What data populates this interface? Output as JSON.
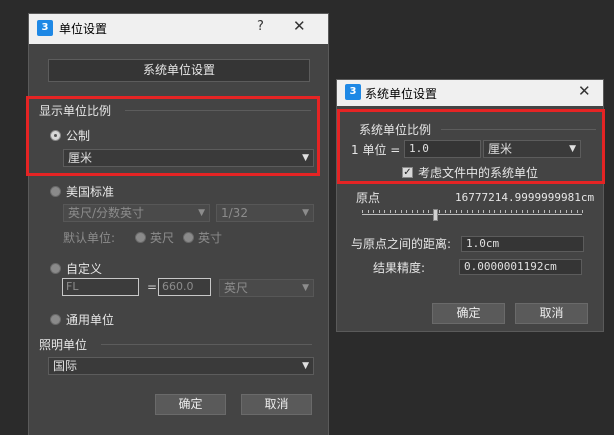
{
  "unit_setup_dialog": {
    "title": "单位设置",
    "icon": "3dsmax-app-icon",
    "help_label": "?",
    "close_label": "✕",
    "system_unit_setup_button": "系统单位设置",
    "display_group": {
      "title": "显示单位比例",
      "metric": {
        "label": "公制",
        "selected": true,
        "unit": "厘米"
      },
      "us_standard": {
        "label": "美国标准",
        "selected": false,
        "unit": "英尺/分数英寸",
        "fraction": "1/32",
        "default_unit_label": "默认单位:",
        "option_feet": "英尺",
        "option_inch": "英寸"
      },
      "custom": {
        "label": "自定义",
        "selected": false,
        "name_value": "FL",
        "equals": "=",
        "number_value": "660.0",
        "unit": "英尺"
      },
      "generic": {
        "label": "通用单位",
        "selected": false
      }
    },
    "lighting_group": {
      "title": "照明单位",
      "value": "国际"
    },
    "ok_button": "确定",
    "cancel_button": "取消"
  },
  "system_unit_dialog": {
    "title": "系统单位设置",
    "icon": "3dsmax-app-icon",
    "close_label": "✕",
    "scale_group_title": "系统单位比例",
    "scale_prefix": "1 单位 =",
    "scale_value": "1.0",
    "scale_unit": "厘米",
    "respect_files_label": "考虑文件中的系统单位",
    "respect_files_checked": true,
    "origin_label": "原点",
    "origin_value": "16777214.9999999981cm",
    "origin_slider_fraction": 0.33,
    "distance_label": "与原点之间的距离:",
    "distance_value": "1.0cm",
    "precision_label": "结果精度:",
    "precision_value": "0.0000001192cm",
    "ok_button": "确定",
    "cancel_button": "取消"
  },
  "colors": {
    "highlight_box": "#e52424",
    "dialog_bg": "#444444",
    "titlebar_bg": "#f0f0f0"
  }
}
